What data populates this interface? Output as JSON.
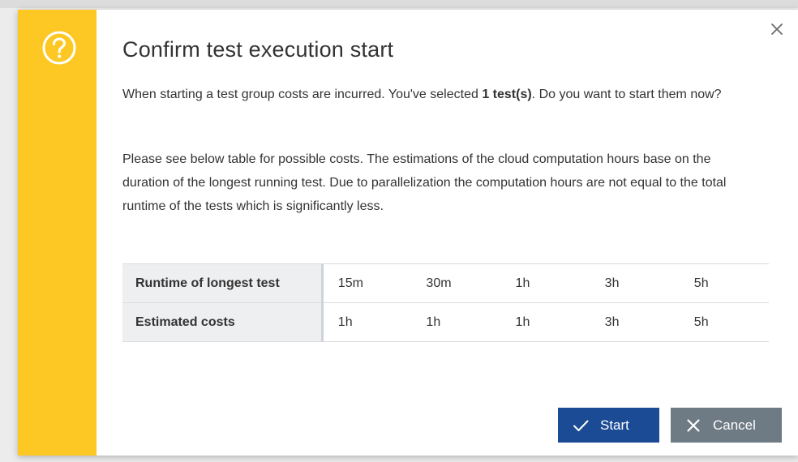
{
  "dialog": {
    "title": "Confirm test execution start",
    "intro_prefix": "When starting a test group costs are incurred. You've selected ",
    "intro_bold": "1 test(s)",
    "intro_suffix": ". Do you want to start them now?",
    "explanation": "Please see below table for possible costs. The estimations of the cloud computation hours base on the duration of the longest running test. Due to parallelization the computation hours are not equal to the total runtime of the tests which is significantly less.",
    "table": {
      "rows": [
        {
          "header": "Runtime of longest test",
          "values": [
            "15m",
            "30m",
            "1h",
            "3h",
            "5h"
          ]
        },
        {
          "header": "Estimated costs",
          "values": [
            "1h",
            "1h",
            "1h",
            "3h",
            "5h"
          ]
        }
      ]
    },
    "start_label": "Start",
    "cancel_label": "Cancel"
  },
  "icons": {
    "accent": "question-circle-icon",
    "close": "close-icon",
    "start": "checkmark-icon",
    "cancel": "x-icon"
  },
  "colors": {
    "accent": "#fdc823",
    "primary_button": "#1b4b95",
    "secondary_button": "#6e7a84"
  }
}
